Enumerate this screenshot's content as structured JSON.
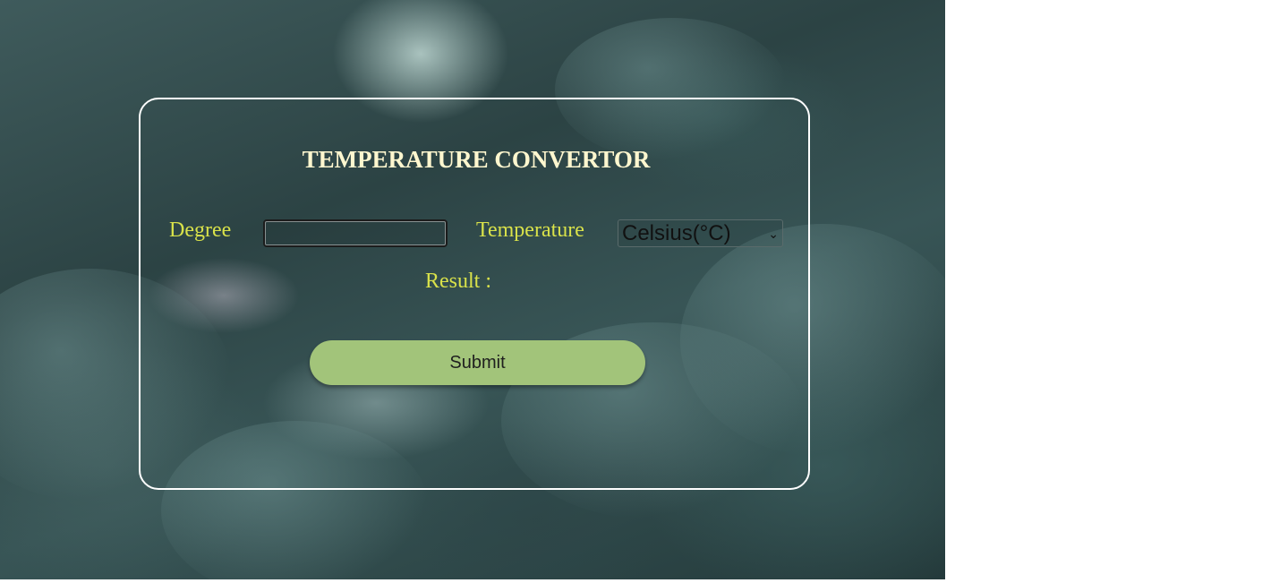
{
  "form": {
    "title": "TEMPERATURE CONVERTOR",
    "degree_label": "Degree",
    "degree_value": "",
    "temperature_label": "Temperature",
    "unit_selected": "Celsius(°C)",
    "result_label": "Result :",
    "submit_label": "Submit"
  },
  "colors": {
    "title": "#fff7cf",
    "label": "#d9e24a",
    "button": "#a2c47a",
    "card_border": "#ffffff"
  }
}
